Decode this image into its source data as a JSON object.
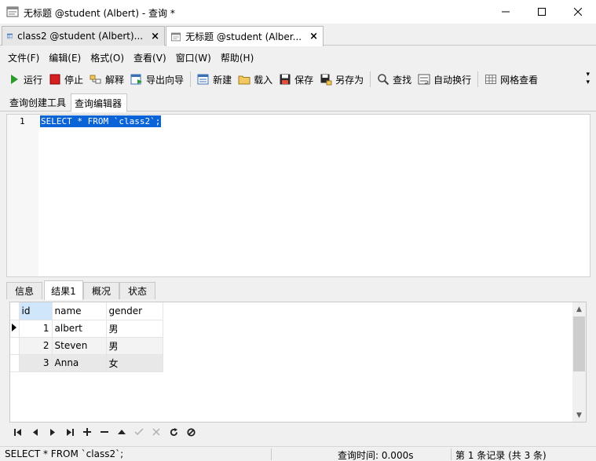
{
  "window": {
    "title": "无标题 @student (Albert) - 查询 *",
    "icon": "query-app-icon",
    "controls": [
      "minimize-icon",
      "maximize-icon",
      "close-icon"
    ]
  },
  "doc_tabs": [
    {
      "label": "class2 @student (Albert)...",
      "active": false
    },
    {
      "label": "无标题 @student (Alber...",
      "active": true
    }
  ],
  "menu": [
    "文件(F)",
    "编辑(E)",
    "格式(O)",
    "查看(V)",
    "窗口(W)",
    "帮助(H)"
  ],
  "toolbar": {
    "run": "运行",
    "stop": "停止",
    "explain": "解释",
    "export_wizard": "导出向导",
    "new": "新建",
    "load": "载入",
    "save": "保存",
    "save_as": "另存为",
    "find": "查找",
    "word_wrap": "自动换行",
    "grid_view": "网格查看"
  },
  "editor_tabs": [
    "查询创建工具",
    "查询编辑器"
  ],
  "editor": {
    "line_number": "1",
    "sql": "SELECT * FROM `class2`;"
  },
  "result_tabs": [
    "信息",
    "结果1",
    "概况",
    "状态"
  ],
  "grid": {
    "columns": [
      "id",
      "name",
      "gender"
    ],
    "rows": [
      {
        "id": "1",
        "name": "albert",
        "gender": "男"
      },
      {
        "id": "2",
        "name": "Steven",
        "gender": "男"
      },
      {
        "id": "3",
        "name": "Anna",
        "gender": "女"
      }
    ]
  },
  "status": {
    "sql": "SELECT * FROM `class2`;",
    "query_time": "查询时间: 0.000s",
    "record": "第 1 条记录 (共 3 条)"
  },
  "colors": {
    "selection": "#0a64d8",
    "run_green": "#2a9a2a",
    "stop_red": "#d42020",
    "header_highlight": "#cfe6fb"
  }
}
